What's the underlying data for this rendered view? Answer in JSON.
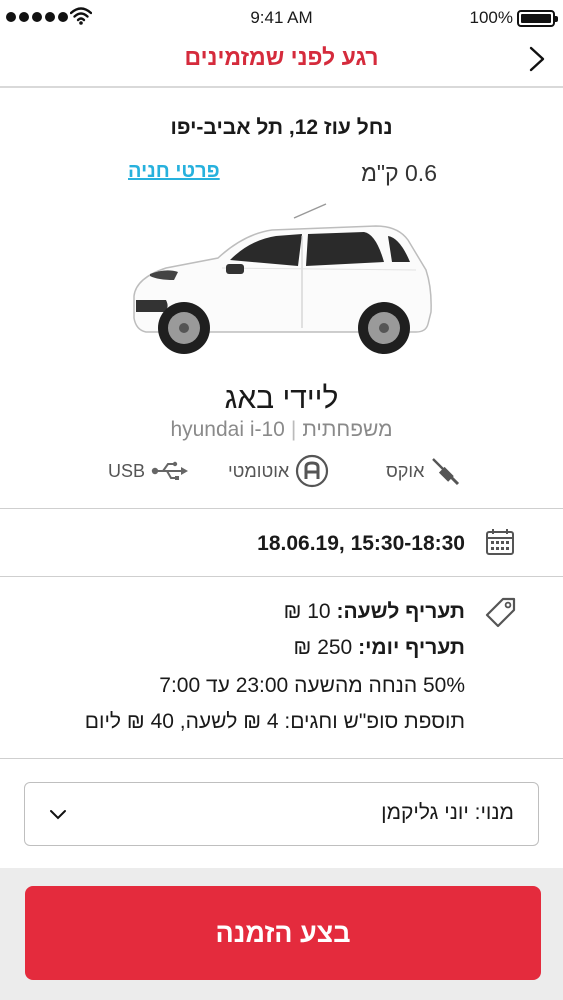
{
  "status_bar": {
    "time": "9:41 AM",
    "battery": "100%",
    "battery_level": 1.0
  },
  "header": {
    "title": "רגע לפני שמזמינים",
    "back_icon": "chevron-right-icon"
  },
  "location": {
    "address": "נחל עוז 12, תל אביב-יפו",
    "distance": "0.6 ק\"מ",
    "parking_link": "פרטי חניה"
  },
  "car": {
    "name": "ליידי באג",
    "model": "hyundai i-10",
    "category": "משפחתית",
    "color": "#ffffff"
  },
  "features": [
    {
      "label": "אוקס",
      "icon": "aux-cable-icon"
    },
    {
      "label": "אוטומטי",
      "icon": "automatic-gear-icon"
    },
    {
      "label": "USB",
      "icon": "usb-icon"
    }
  ],
  "booking": {
    "date_time": "15:30-18:30 ,18.06.19",
    "calendar_icon": "calendar-icon"
  },
  "pricing": {
    "tag_icon": "price-tag-icon",
    "hourly_label": "תעריף לשעה:",
    "hourly_value": "10 ₪",
    "daily_label": "תעריף יומי:",
    "daily_value": "250 ₪",
    "discount": "50% הנחה מהשעה 23:00 עד 7:00",
    "weekend": "תוספת סופ\"ש וחגים: 4 ₪ לשעה, 40 ₪ ליום"
  },
  "subscription": {
    "selected": "מנוי: יוני גליקמן"
  },
  "actions": {
    "order_label": "בצע הזמנה"
  },
  "colors": {
    "accent": "#e42b3d",
    "title_red": "#d52b3c",
    "link": "#27b1dd"
  }
}
